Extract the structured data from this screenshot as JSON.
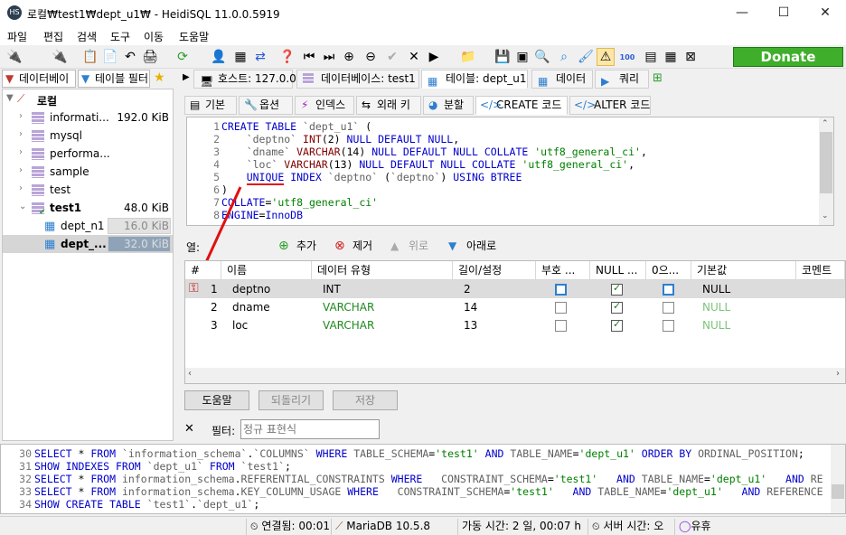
{
  "window": {
    "title": "로컬₩test1₩dept_u1₩ - HeidiSQL 11.0.0.5919",
    "minimize": "—",
    "maximize": "☐",
    "close": "✕"
  },
  "menu": [
    "파일",
    "편집",
    "검색",
    "도구",
    "이동",
    "도움말"
  ],
  "donate": "Donate",
  "left_tabs": [
    "데이터베이",
    "테이블 필터"
  ],
  "tree": {
    "root": "로컬",
    "items": [
      {
        "label": "informati...",
        "size": "192.0 KiB"
      },
      {
        "label": "mysql",
        "size": ""
      },
      {
        "label": "performa...",
        "size": ""
      },
      {
        "label": "sample",
        "size": ""
      },
      {
        "label": "test",
        "size": ""
      },
      {
        "label": "test1",
        "size": "48.0 KiB"
      }
    ],
    "tables": [
      {
        "label": "dept_n1",
        "size": "16.0 KiB"
      },
      {
        "label": "dept_...",
        "size": "32.0 KiB"
      }
    ]
  },
  "main_tabs": [
    "호스트: 127.0.0.1",
    "데이터베이스: test1",
    "테이블: dept_u1",
    "데이터",
    "쿼리"
  ],
  "sub_tabs": [
    "기본",
    "옵션",
    "인덱스",
    "외래 키",
    "분할",
    "CREATE 코드",
    "ALTER 코드"
  ],
  "code": {
    "lines": [
      "1",
      "2",
      "3",
      "4",
      "5",
      "6",
      "7",
      "8"
    ]
  },
  "columns_bar": {
    "label": "열:",
    "add": "추가",
    "remove": "제거",
    "up": "위로",
    "down": "아래로"
  },
  "grid": {
    "headers": [
      "#",
      "이름",
      "데이터 유형",
      "길이/설정",
      "부호 ...",
      "NULL ...",
      "0으...",
      "기본값",
      "코멘트"
    ],
    "rows": [
      {
        "num": "1",
        "name": "deptno",
        "type": "INT",
        "length": "2",
        "default": "NULL"
      },
      {
        "num": "2",
        "name": "dname",
        "type": "VARCHAR",
        "length": "14",
        "default": "NULL"
      },
      {
        "num": "3",
        "name": "loc",
        "type": "VARCHAR",
        "length": "13",
        "default": "NULL"
      }
    ]
  },
  "buttons": {
    "help": "도움말",
    "revert": "되돌리기",
    "save": "저장"
  },
  "filter": {
    "close": "✕",
    "label": "필터:",
    "placeholder": "정규 표현식"
  },
  "log": {
    "nums": [
      "30",
      "31",
      "32",
      "33",
      "34"
    ]
  },
  "status": {
    "connected": "연결됨: 00:01",
    "server": "MariaDB 10.5.8",
    "uptime": "가동 시간: 2 일, 00:07 h",
    "server_time": "서버 시간: 오",
    "idle": "유휴"
  },
  "colors": {
    "accent": "#0078d7",
    "donate": "#3fae2a",
    "arrow": "#e01010"
  }
}
